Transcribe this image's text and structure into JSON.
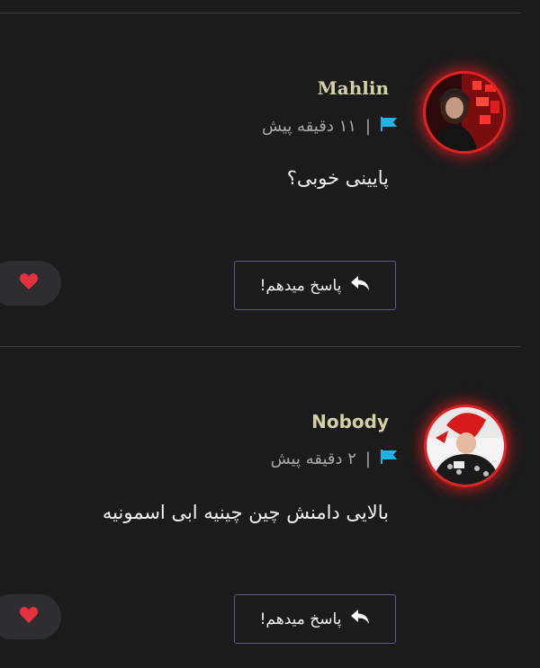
{
  "comments": [
    {
      "username": "Mahlin",
      "time": "۱۱ دقیقه پیش",
      "separator": "|",
      "text": "پایینی خوبی؟",
      "reply_label": "پاسخ میدهم!"
    },
    {
      "username": "Nobody",
      "time": "۲ دقیقه پیش",
      "separator": "|",
      "text": "بالایی دامنش چین چینیه ابی اسمونیه",
      "reply_label": "پاسخ میدهم!"
    }
  ],
  "icons": {
    "flag": "flag-icon",
    "reply": "reply-arrow-icon",
    "like": "heart-icon"
  },
  "colors": {
    "background": "#1b1b1c",
    "username": "#d4d0a6",
    "flag": "#19b3e6",
    "avatar_ring": "#e02222",
    "like_bg": "#2e2e30",
    "reply_border": "#5b5f86",
    "heart": "#e8313f"
  }
}
